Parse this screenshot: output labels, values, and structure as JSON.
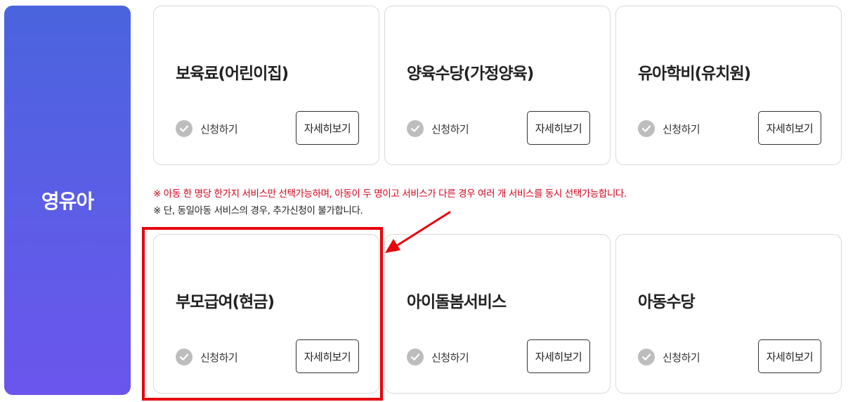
{
  "sidebar": {
    "title": "영유아"
  },
  "cards": [
    {
      "title": "보육료(어린이집)",
      "apply_label": "신청하기",
      "detail_label": "자세히보기"
    },
    {
      "title": "양육수당(가정양육)",
      "apply_label": "신청하기",
      "detail_label": "자세히보기"
    },
    {
      "title": "유아학비(유치원)",
      "apply_label": "신청하기",
      "detail_label": "자세히보기"
    },
    {
      "title": "부모급여(현금)",
      "apply_label": "신청하기",
      "detail_label": "자세히보기"
    },
    {
      "title": "아이돌봄서비스",
      "apply_label": "신청하기",
      "detail_label": "자세히보기"
    },
    {
      "title": "아동수당",
      "apply_label": "신청하기",
      "detail_label": "자세히보기"
    }
  ],
  "notice": {
    "line1": "※ 아동 한 명당 한가지 서비스만 선택가능하며, 아동이 두 명이고 서비스가 다른 경우 여러 개 서비스를 동시 선택가능합니다.",
    "line2": "※ 단, 동일아동 서비스의 경우, 추가신청이 불가합니다."
  },
  "colors": {
    "sidebar_gradient_start": "#4a64de",
    "sidebar_gradient_end": "#6b55ec",
    "notice_red": "#d0021b",
    "highlight_red": "#e8000b",
    "check_gray": "#bdbdbd"
  }
}
